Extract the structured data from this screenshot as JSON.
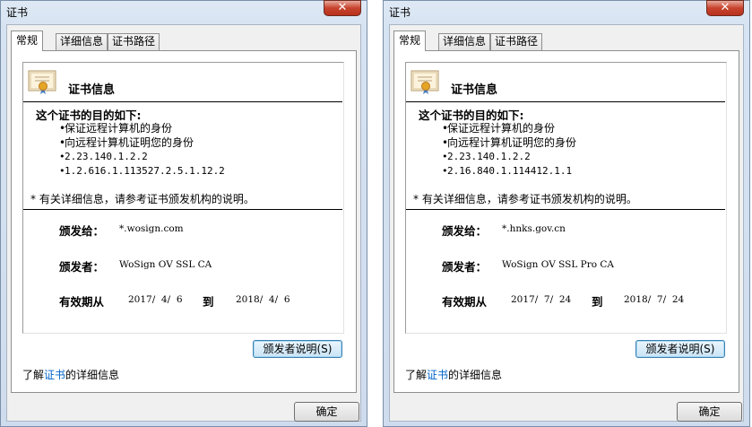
{
  "windows": [
    {
      "title": "证书",
      "close_glyph": "✕",
      "tabs": [
        "常规",
        "详细信息",
        "证书路径"
      ],
      "heading": "证书信息",
      "purpose_title": "这个证书的目的如下:",
      "purposes": [
        "保证远程计算机的身份",
        "向远程计算机证明您的身份",
        "2.23.140.1.2.2",
        "1.2.616.1.113527.2.5.1.12.2"
      ],
      "note": "* 有关详细信息，请参考证书颁发机构的说明。",
      "issued_to_label": "颁发给：",
      "issued_to": "*.wosign.com",
      "issued_by_label": "颁发者：",
      "issued_by": "WoSign OV SSL CA",
      "valid_label": "有效期从",
      "valid_from": "2017/  4/  6",
      "to_label": "到",
      "valid_to": "2018/  4/  6",
      "issuer_statement_button": "颁发者说明(S)",
      "learn_prefix": "了解",
      "learn_link": "证书",
      "learn_suffix": "的详细信息",
      "ok_button": "确定"
    },
    {
      "title": "证书",
      "close_glyph": "✕",
      "tabs": [
        "常规",
        "详细信息",
        "证书路径"
      ],
      "heading": "证书信息",
      "purpose_title": "这个证书的目的如下:",
      "purposes": [
        "保证远程计算机的身份",
        "向远程计算机证明您的身份",
        "2.23.140.1.2.2",
        "2.16.840.1.114412.1.1"
      ],
      "note": "* 有关详细信息，请参考证书颁发机构的说明。",
      "issued_to_label": "颁发给：",
      "issued_to": "*.hnks.gov.cn",
      "issued_by_label": "颁发者：",
      "issued_by": "WoSign OV SSL Pro CA",
      "valid_label": "有效期从",
      "valid_from": "2017/  7/  24",
      "to_label": "到",
      "valid_to": "2018/  7/  24",
      "issuer_statement_button": "颁发者说明(S)",
      "learn_prefix": "了解",
      "learn_link": "证书",
      "learn_suffix": "的详细信息",
      "ok_button": "确定"
    }
  ]
}
